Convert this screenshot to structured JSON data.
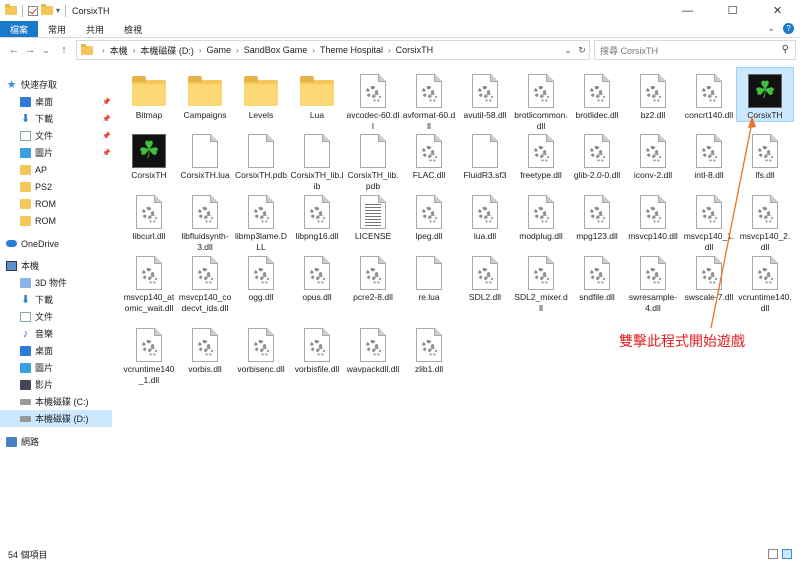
{
  "window": {
    "title": "CorsixTH",
    "minimize": "—",
    "maximize": "☐",
    "close": "✕"
  },
  "ribbon": {
    "tabs": [
      "檔案",
      "常用",
      "共用",
      "檢視"
    ],
    "expand": "⌄",
    "help": "?"
  },
  "nav": {
    "back": "←",
    "forward": "→",
    "recent": "⌄",
    "up": "↑",
    "breadcrumbs": [
      "本機",
      "本機磁碟 (D:)",
      "Game",
      "SandBox Game",
      "Theme Hospital",
      "CorsixTH"
    ],
    "dropdown": "⌄",
    "refresh": "↻",
    "search_placeholder": "搜尋 CorsixTH"
  },
  "sidebar": {
    "items": [
      {
        "label": "快速存取",
        "icon": "star-icon"
      },
      {
        "label": "桌面",
        "icon": "desktop-icon",
        "pinned": true
      },
      {
        "label": "下載",
        "icon": "download-icon",
        "pinned": true
      },
      {
        "label": "文件",
        "icon": "documents-icon",
        "pinned": true
      },
      {
        "label": "圖片",
        "icon": "pictures-icon",
        "pinned": true
      },
      {
        "label": "AP",
        "icon": "folder-icon"
      },
      {
        "label": "PS2",
        "icon": "folder-icon"
      },
      {
        "label": "ROM",
        "icon": "folder-icon"
      },
      {
        "label": "ROM",
        "icon": "folder-icon"
      },
      {
        "label": "OneDrive",
        "icon": "cloud-icon"
      },
      {
        "label": "本機",
        "icon": "pc-icon"
      },
      {
        "label": "3D 物件",
        "icon": "3d-objects-icon"
      },
      {
        "label": "下載",
        "icon": "download-icon"
      },
      {
        "label": "文件",
        "icon": "documents-icon"
      },
      {
        "label": "音樂",
        "icon": "music-icon"
      },
      {
        "label": "桌面",
        "icon": "desktop-icon"
      },
      {
        "label": "圖片",
        "icon": "pictures-icon"
      },
      {
        "label": "影片",
        "icon": "videos-icon"
      },
      {
        "label": "本機磁碟 (C:)",
        "icon": "drive-icon"
      },
      {
        "label": "本機磁碟 (D:)",
        "icon": "drive-icon",
        "selected": true
      },
      {
        "label": "網路",
        "icon": "network-icon"
      }
    ]
  },
  "files": [
    {
      "name": "Bitmap",
      "type": "folder"
    },
    {
      "name": "Campaigns",
      "type": "folder"
    },
    {
      "name": "Levels",
      "type": "folder"
    },
    {
      "name": "Lua",
      "type": "folder"
    },
    {
      "name": "avcodec-60.dll",
      "type": "dll"
    },
    {
      "name": "avformat-60.dll",
      "type": "dll"
    },
    {
      "name": "avutil-58.dll",
      "type": "dll"
    },
    {
      "name": "brotlicommon.dll",
      "type": "dll"
    },
    {
      "name": "brotlidec.dll",
      "type": "dll"
    },
    {
      "name": "bz2.dll",
      "type": "dll"
    },
    {
      "name": "concrt140.dll",
      "type": "dll"
    },
    {
      "name": "CorsixTH",
      "type": "exe",
      "selected": true
    },
    {
      "name": "CorsixTH",
      "type": "exe"
    },
    {
      "name": "CorsixTH.lua",
      "type": "file"
    },
    {
      "name": "CorsixTH.pdb",
      "type": "file"
    },
    {
      "name": "CorsixTH_lib.lib",
      "type": "file"
    },
    {
      "name": "CorsixTH_lib.pdb",
      "type": "file"
    },
    {
      "name": "FLAC.dll",
      "type": "dll"
    },
    {
      "name": "FluidR3.sf3",
      "type": "file"
    },
    {
      "name": "freetype.dll",
      "type": "dll"
    },
    {
      "name": "glib-2.0-0.dll",
      "type": "dll"
    },
    {
      "name": "iconv-2.dll",
      "type": "dll"
    },
    {
      "name": "intl-8.dll",
      "type": "dll"
    },
    {
      "name": "lfs.dll",
      "type": "dll"
    },
    {
      "name": "libcurl.dll",
      "type": "dll"
    },
    {
      "name": "libfluidsynth-3.dll",
      "type": "dll"
    },
    {
      "name": "libmp3lame.DLL",
      "type": "dll"
    },
    {
      "name": "libpng16.dll",
      "type": "dll"
    },
    {
      "name": "LICENSE",
      "type": "text"
    },
    {
      "name": "lpeg.dll",
      "type": "dll"
    },
    {
      "name": "lua.dll",
      "type": "dll"
    },
    {
      "name": "modplug.dll",
      "type": "dll"
    },
    {
      "name": "mpg123.dll",
      "type": "dll"
    },
    {
      "name": "msvcp140.dll",
      "type": "dll"
    },
    {
      "name": "msvcp140_1.dll",
      "type": "dll"
    },
    {
      "name": "msvcp140_2.dll",
      "type": "dll"
    },
    {
      "name": "msvcp140_atomic_wait.dll",
      "type": "dll"
    },
    {
      "name": "msvcp140_codecvt_ids.dll",
      "type": "dll"
    },
    {
      "name": "ogg.dll",
      "type": "dll"
    },
    {
      "name": "opus.dll",
      "type": "dll"
    },
    {
      "name": "pcre2-8.dll",
      "type": "dll"
    },
    {
      "name": "re.lua",
      "type": "file"
    },
    {
      "name": "SDL2.dll",
      "type": "dll"
    },
    {
      "name": "SDL2_mixer.dll",
      "type": "dll"
    },
    {
      "name": "sndfile.dll",
      "type": "dll"
    },
    {
      "name": "swresample-4.dll",
      "type": "dll"
    },
    {
      "name": "swscale-7.dll",
      "type": "dll"
    },
    {
      "name": "vcruntime140.dll",
      "type": "dll"
    },
    {
      "name": "vcruntime140_1.dll",
      "type": "dll"
    },
    {
      "name": "vorbis.dll",
      "type": "dll"
    },
    {
      "name": "vorbisenc.dll",
      "type": "dll"
    },
    {
      "name": "vorbisfile.dll",
      "type": "dll"
    },
    {
      "name": "wavpackdll.dll",
      "type": "dll"
    },
    {
      "name": "zlib1.dll",
      "type": "dll"
    }
  ],
  "annotation": {
    "text": "雙擊此程式開始遊戲",
    "color": "#e02020"
  },
  "status": {
    "count": "54 個項目"
  },
  "colors": {
    "accent": "#1979ca",
    "selection": "#cce8ff",
    "folder": "#f5c75a"
  }
}
